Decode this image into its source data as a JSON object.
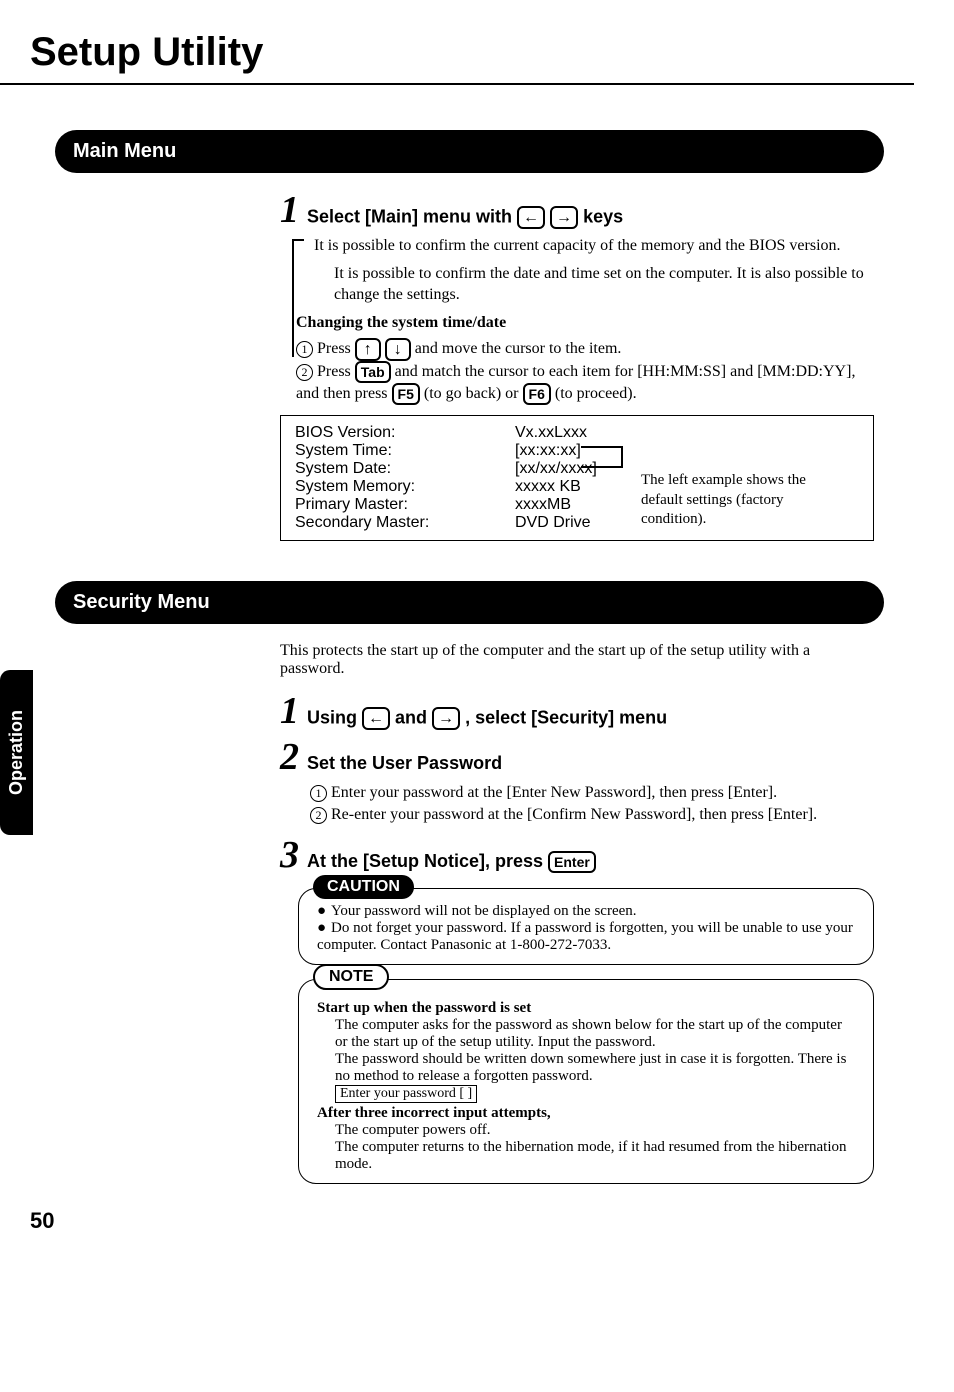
{
  "page": {
    "title": "Setup Utility",
    "number": "50",
    "sideTab": "Operation"
  },
  "mainMenu": {
    "header": "Main Menu",
    "step1": {
      "num": "1",
      "title_a": "Select [Main] menu with ",
      "title_b": " keys",
      "intro1": "It is possible to confirm the current capacity of the memory and the BIOS version.",
      "intro2": "It is possible to confirm the date and time set on the computer. It is also possible to change the settings.",
      "changeHeading": "Changing the system time/date",
      "line1_a": " Press",
      "line1_b": " and move the cursor to the item.",
      "line2_a": " Press ",
      "line2_b": " and match the cursor to each item for [HH:MM:SS] and [MM:DD:YY], and then press",
      "line2_c": " (to go back) or",
      "line2_d": " (to proceed).",
      "tabKey": "Tab",
      "f5Key": "F5",
      "f6Key": "F6"
    },
    "bios": {
      "labels": {
        "version": "BIOS Version:",
        "time": "System Time:",
        "date": "System Date:",
        "memory": "System Memory:",
        "primary": "Primary Master:",
        "secondary": "Secondary Master:"
      },
      "values": {
        "version": "Vx.xxLxxx",
        "time": "[xx:xx:xx]",
        "date": "[xx/xx/xxxx]",
        "memory": "xxxxx KB",
        "primary": "xxxxMB",
        "secondary": "DVD Drive"
      },
      "sideNote": "The left example shows the default settings (factory condition)."
    }
  },
  "securityMenu": {
    "header": "Security Menu",
    "intro": "This protects the start up of the computer and the start up of the setup utility with a password.",
    "step1": {
      "num": "1",
      "title_a": "Using ",
      "title_mid": " and ",
      "title_b": " , select [Security] menu"
    },
    "step2": {
      "num": "2",
      "title": "Set the User Password",
      "l1": " Enter your password at the [Enter New Password], then press [Enter].",
      "l2": " Re-enter your password at the [Confirm New Password], then press [Enter]."
    },
    "step3": {
      "num": "3",
      "title_a": "At the [Setup Notice], press ",
      "enterKey": "Enter"
    },
    "caution": {
      "label": "CAUTION",
      "b1": "Your password will not be displayed on the screen.",
      "b2": "Do not forget your password. If a password is forgotten, you will be unable to use your computer. Contact Panasonic at 1-800-272-7033."
    },
    "note": {
      "label": "NOTE",
      "h1": "Start up when the password is set",
      "p1": "The computer asks for the password as shown below for the start up of the computer or the start up of the setup utility. Input the password.",
      "p2": "The password should be written down somewhere just in case it is forgotten. There is no method to release a forgotten password.",
      "inputLabel": "Enter your password [               ]",
      "h2": "After three incorrect input attempts,",
      "p3": "The computer powers off.",
      "p4": "The computer returns to the hibernation mode, if it had resumed from the hibernation mode."
    }
  }
}
